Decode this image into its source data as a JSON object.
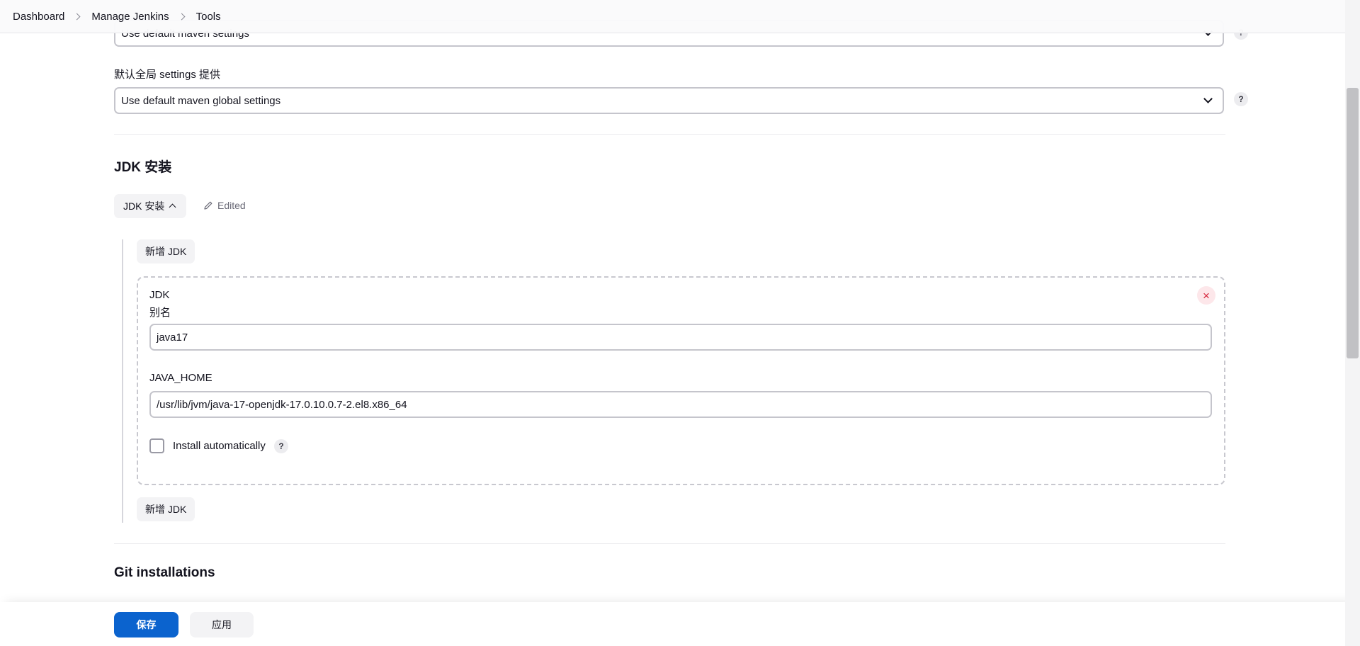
{
  "breadcrumb": {
    "items": [
      "Dashboard",
      "Manage Jenkins",
      "Tools"
    ]
  },
  "maven": {
    "settings_value": "Use default maven settings",
    "global_settings_label": "默认全局 settings 提供",
    "global_settings_value": "Use default maven global settings"
  },
  "jdk_section": {
    "title": "JDK 安装",
    "toggle_label": "JDK 安装",
    "edited_label": "Edited",
    "add_button_label": "新增 JDK",
    "card": {
      "heading": "JDK",
      "close_symbol": "×",
      "name_label": "别名",
      "name_value": "java17",
      "java_home_label": "JAVA_HOME",
      "java_home_value": "/usr/lib/jvm/java-17-openjdk-17.0.10.0.7-2.el8.x86_64",
      "install_auto_label": "Install automatically",
      "install_auto_checked": false
    }
  },
  "git_section": {
    "title": "Git installations"
  },
  "help_symbol": "?",
  "footer": {
    "save_label": "保存",
    "apply_label": "应用"
  },
  "colors": {
    "primary": "#0b63ce",
    "danger": "#d6243a"
  }
}
